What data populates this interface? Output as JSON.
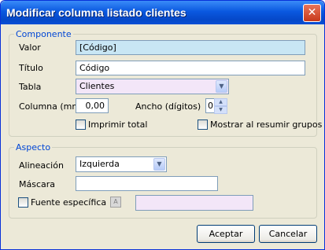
{
  "window": {
    "title": "Modificar columna listado clientes",
    "close_glyph": "✕"
  },
  "componente": {
    "legend": "Componente",
    "valor": {
      "label": "Valor",
      "value": "[Código]",
      "bg": "#c8e6f4"
    },
    "titulo": {
      "label": "Título",
      "value": "Código"
    },
    "tabla": {
      "label": "Tabla",
      "value": "Clientes",
      "bg": "#f3e6f8"
    },
    "columna": {
      "label": "Columna (mm)",
      "value": "0,00"
    },
    "ancho": {
      "label": "Ancho (dígitos)",
      "value": "0"
    },
    "imprimir_total": {
      "label": "Imprimir total",
      "checked": false
    },
    "mostrar_resumir": {
      "label": "Mostrar al resumir grupos",
      "checked": false
    }
  },
  "aspecto": {
    "legend": "Aspecto",
    "alineacion": {
      "label": "Alineación",
      "value": "Izquierda"
    },
    "mascara": {
      "label": "Máscara",
      "value": ""
    },
    "fuente": {
      "label": "Fuente específica",
      "checked": false,
      "preview_bg": "#f3e6f8"
    }
  },
  "buttons": {
    "accept": "Aceptar",
    "cancel": "Cancelar"
  },
  "icons": {
    "dropdown": "chevron-down-icon",
    "spin_up": "▲",
    "spin_down": "▼",
    "combo_arrow": "▼",
    "font_glyph": "A"
  }
}
